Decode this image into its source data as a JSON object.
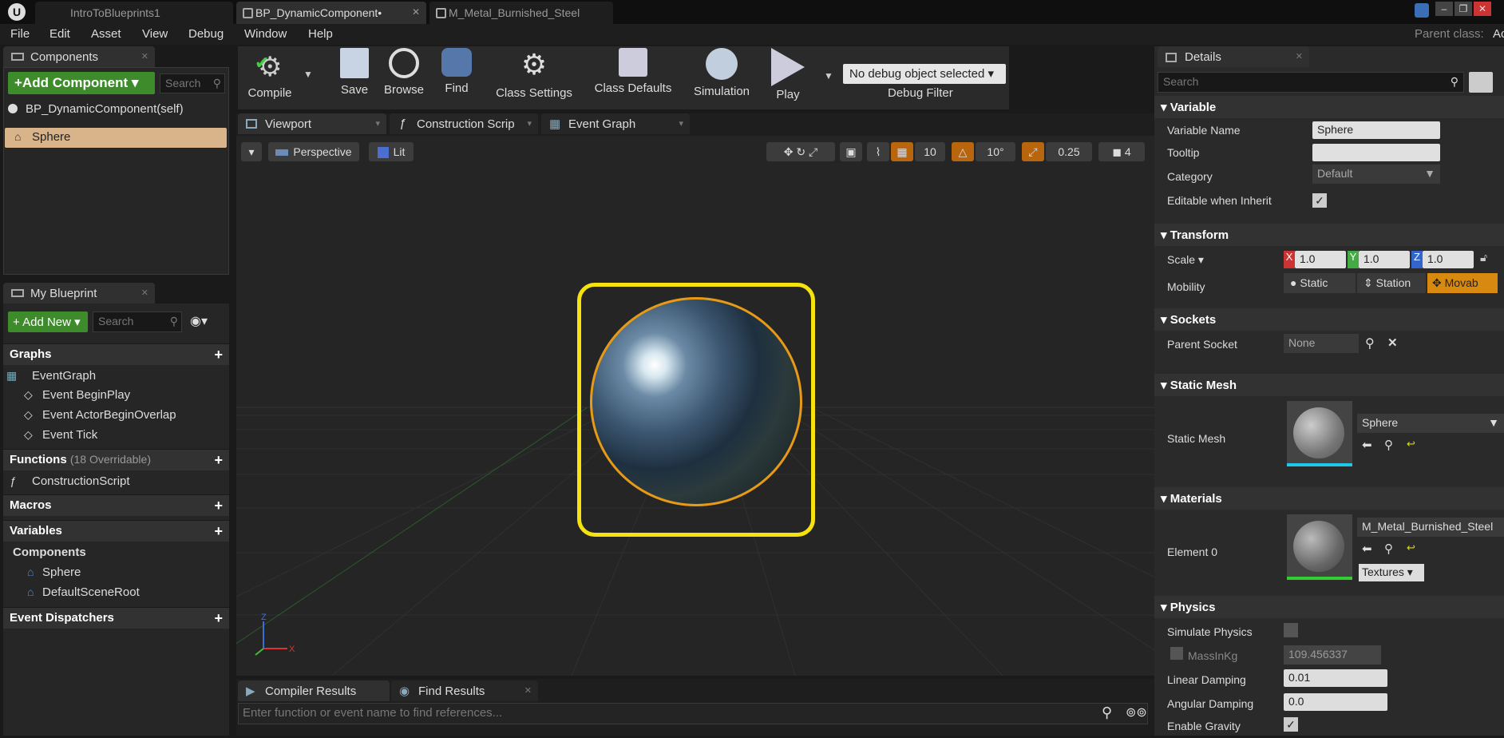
{
  "window": {
    "tabs": [
      {
        "label": "IntroToBlueprints1"
      },
      {
        "label": "BP_DynamicComponent•"
      },
      {
        "label": "M_Metal_Burnished_Steel"
      }
    ],
    "parent_class_label": "Parent class:",
    "parent_class_value": "Ac"
  },
  "menu": [
    "File",
    "Edit",
    "Asset",
    "View",
    "Debug",
    "Window",
    "Help"
  ],
  "components_panel": {
    "tab": "Components",
    "add_button": "+Add Component",
    "search_placeholder": "Search",
    "root": "BP_DynamicComponent(self)",
    "selected": "Sphere"
  },
  "my_blueprint": {
    "tab": "My Blueprint",
    "add_new": "Add New",
    "search_placeholder": "Search",
    "graphs_label": "Graphs",
    "event_graph": "EventGraph",
    "events": [
      "Event BeginPlay",
      "Event ActorBeginOverlap",
      "Event Tick"
    ],
    "functions_label": "Functions",
    "functions_count": "(18 Overridable)",
    "construction_script": "ConstructionScript",
    "macros_label": "Macros",
    "variables_label": "Variables",
    "components_label": "Components",
    "components": [
      "Sphere",
      "DefaultSceneRoot"
    ],
    "dispatchers_label": "Event Dispatchers"
  },
  "toolbar": {
    "compile": "Compile",
    "save": "Save",
    "browse": "Browse",
    "find": "Find",
    "class_settings": "Class Settings",
    "class_defaults": "Class Defaults",
    "simulation": "Simulation",
    "play": "Play",
    "debug_object": "No debug object selected",
    "debug_filter": "Debug Filter"
  },
  "editor_tabs": [
    "Viewport",
    "Construction Scrip",
    "Event Graph"
  ],
  "viewport": {
    "perspective": "Perspective",
    "lit": "Lit",
    "grid_snap": "10",
    "rot_snap": "10°",
    "scale_snap": "0.25",
    "cam_speed": "4",
    "accent": "#b8650e",
    "selection_color": "#f5e20f"
  },
  "bottom": {
    "tabs": [
      "Compiler Results",
      "Find Results"
    ],
    "find_placeholder": "Enter function or event name to find references..."
  },
  "details": {
    "tab": "Details",
    "search_placeholder": "Search",
    "variable": {
      "header": "Variable",
      "name_label": "Variable Name",
      "name_value": "Sphere",
      "tooltip_label": "Tooltip",
      "category_label": "Category",
      "category_value": "Default",
      "editable_label": "Editable when Inherit"
    },
    "transform": {
      "header": "Transform",
      "scale_label": "Scale",
      "x": "1.0",
      "y": "1.0",
      "z": "1.0",
      "mobility_label": "Mobility",
      "mob_static": "Static",
      "mob_stationary": "Station",
      "mob_movable": "Movab"
    },
    "sockets": {
      "header": "Sockets",
      "parent_label": "Parent Socket",
      "parent_value": "None"
    },
    "static_mesh": {
      "header": "Static Mesh",
      "label": "Static Mesh",
      "value": "Sphere"
    },
    "materials": {
      "header": "Materials",
      "label": "Element 0",
      "value": "M_Metal_Burnished_Steel",
      "textures": "Textures"
    },
    "physics": {
      "header": "Physics",
      "simulate": "Simulate Physics",
      "mass_label": "MassInKg",
      "mass_value": "109.456337",
      "linear_label": "Linear Damping",
      "linear_value": "0.01",
      "angular_label": "Angular Damping",
      "angular_value": "0.0",
      "gravity_label": "Enable Gravity"
    }
  }
}
